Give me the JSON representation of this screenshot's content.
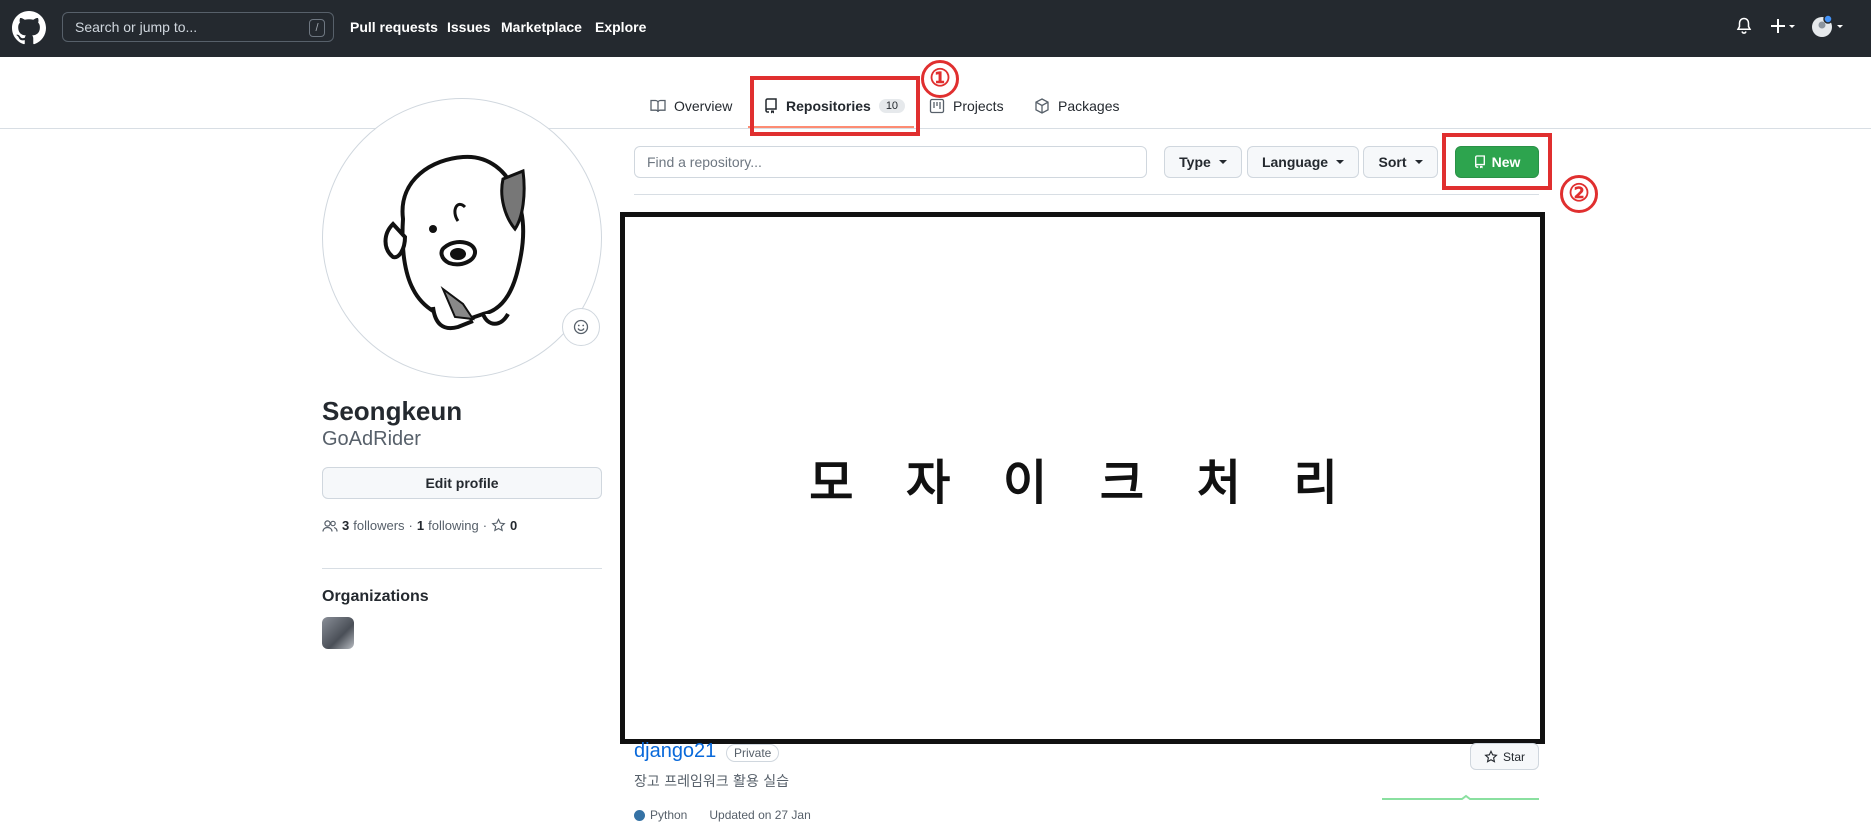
{
  "header": {
    "search_placeholder": "Search or jump to...",
    "slash_key": "/",
    "nav": [
      "Pull requests",
      "Issues",
      "Marketplace",
      "Explore"
    ]
  },
  "tabs": {
    "overview": "Overview",
    "repositories": "Repositories",
    "repositories_count": "10",
    "projects": "Projects",
    "packages": "Packages"
  },
  "annotations": {
    "marker_1": "①",
    "marker_2": "②",
    "mosaic_text": "모 자 이 크 처 리",
    "box_color": "#e02f2f"
  },
  "profile": {
    "name": "Seongkeun",
    "login": "GoAdRider",
    "edit_label": "Edit profile",
    "followers_count": "3",
    "followers_label": "followers",
    "following_count": "1",
    "following_label": "following",
    "stars_count": "0",
    "organizations_title": "Organizations"
  },
  "filters": {
    "find_placeholder": "Find a repository...",
    "type_label": "Type",
    "language_label": "Language",
    "sort_label": "Sort",
    "new_label": "New"
  },
  "repo": {
    "name": "django21",
    "visibility": "Private",
    "star_label": "Star",
    "description": "장고 프레임워크 활용 실습",
    "language": "Python",
    "language_color": "#3572a5",
    "updated": "Updated on 27 Jan"
  }
}
